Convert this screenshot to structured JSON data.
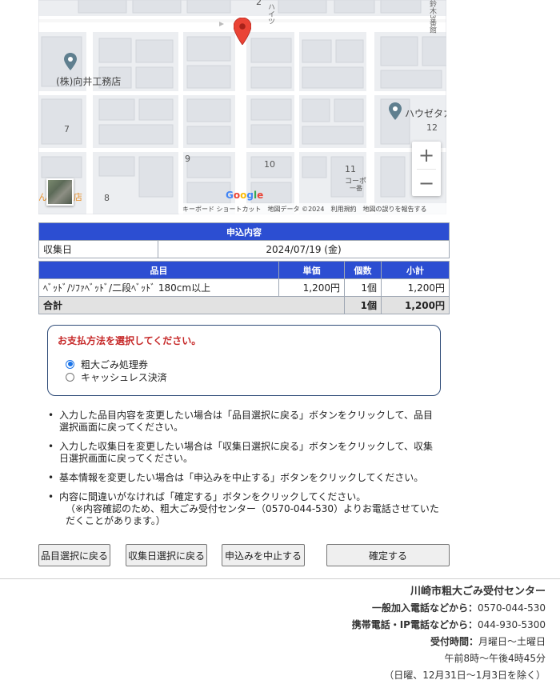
{
  "map": {
    "labels": {
      "n2": "2",
      "haitsu": "ハイツ",
      "side_right": "鈴木3番館",
      "poi1": "(株)向井工務店",
      "poi2": "ハウゼタカ",
      "n7": "7",
      "n9": "9",
      "n10": "10",
      "n11": "11",
      "n12": "12",
      "n8": "8",
      "copo": "コーポ",
      "ichigo": "一番",
      "store": "ん　中央店"
    },
    "google": "Google",
    "footer": {
      "shortcuts": "キーボード ショートカット",
      "mapdata": "地図データ ©2024",
      "terms": "利用規約",
      "report": "地図の誤りを報告する"
    },
    "zoom_in": "+",
    "zoom_out": "−"
  },
  "application": {
    "header": "申込内容",
    "collection_label": "収集日",
    "collection_date": "2024/07/19 (金)"
  },
  "items": {
    "headers": {
      "item": "品目",
      "unit_price": "単価",
      "qty": "個数",
      "subtotal": "小計"
    },
    "rows": [
      {
        "item": "ﾍﾞｯﾄﾞ/ｿﾌｧﾍﾞｯﾄﾞ/二段ﾍﾞｯﾄﾞ 180cm以上",
        "unit_price": "1,200円",
        "qty": "1個",
        "subtotal": "1,200円"
      }
    ],
    "total": {
      "label": "合計",
      "qty": "1個",
      "subtotal": "1,200円"
    }
  },
  "payment": {
    "title": "お支払方法を選択してください。",
    "options": [
      {
        "label": "粗大ごみ処理券",
        "checked": true
      },
      {
        "label": "キャッシュレス決済",
        "checked": false
      }
    ]
  },
  "notes": [
    {
      "line1": "入力した品目内容を変更したい場合は「品目選択に戻る」ボタンをクリックして、品目",
      "line2": "選択画面に戻ってください。"
    },
    {
      "line1": "入力した収集日を変更したい場合は「収集日選択に戻る」ボタンをクリックして、収集",
      "line2": "日選択画面に戻ってください。"
    },
    {
      "line1": "基本情報を変更したい場合は「申込みを中止する」ボタンをクリックしてください。"
    },
    {
      "line1": "内容に間違いがなければ「確定する」ボタンをクリックしてください。",
      "line2": "（※内容確認のため、粗大ごみ受付センター（0570-044-530）よりお電話させていた",
      "line3": "だくことがあります。）"
    }
  ],
  "buttons": {
    "back_items": "品目選択に戻る",
    "back_date": "収集日選択に戻る",
    "cancel": "申込みを中止する",
    "confirm": "確定する"
  },
  "footer": {
    "name": "川崎市粗大ごみ受付センター",
    "landline_label": "一般加入電話などから：",
    "landline": "0570-044-530",
    "mobile_label": "携帯電話・IP電話などから：",
    "mobile": "044-930-5300",
    "hours_label": "受付時間：",
    "days": "月曜日～土曜日",
    "time": "午前8時～午後4時45分",
    "excluded": "（日曜、12月31日～1月3日を除く）"
  },
  "colors": {
    "table_header": "#2c4ed2",
    "pin": "#ea4335",
    "poi": "#5f7f8f",
    "alert": "#c62828"
  }
}
